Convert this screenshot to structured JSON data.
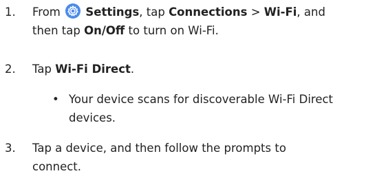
{
  "steps": [
    {
      "number": "1.",
      "from": "From",
      "settings": "Settings",
      "comma_tap": ", tap",
      "connections": "Connections",
      "chevron": ">",
      "wifi": "Wi-Fi",
      "and_line": ", and",
      "then_tap": "then tap",
      "onoff": "On/Off",
      "to_turn": "to turn on Wi-Fi."
    },
    {
      "number": "2.",
      "tap": "Tap",
      "wifi_direct": "Wi-Fi Direct",
      "period": "."
    },
    {
      "bullet": "•",
      "text_line1": "Your device scans for discoverable Wi-Fi Direct",
      "text_line2": "devices."
    },
    {
      "number": "3.",
      "text_line1": "Tap a device, and then follow the prompts to",
      "text_line2": "connect."
    }
  ],
  "icons": {
    "settings": "settings-gear-icon"
  },
  "colors": {
    "text": "#222222",
    "icon_bg": "#4A8BEA"
  }
}
